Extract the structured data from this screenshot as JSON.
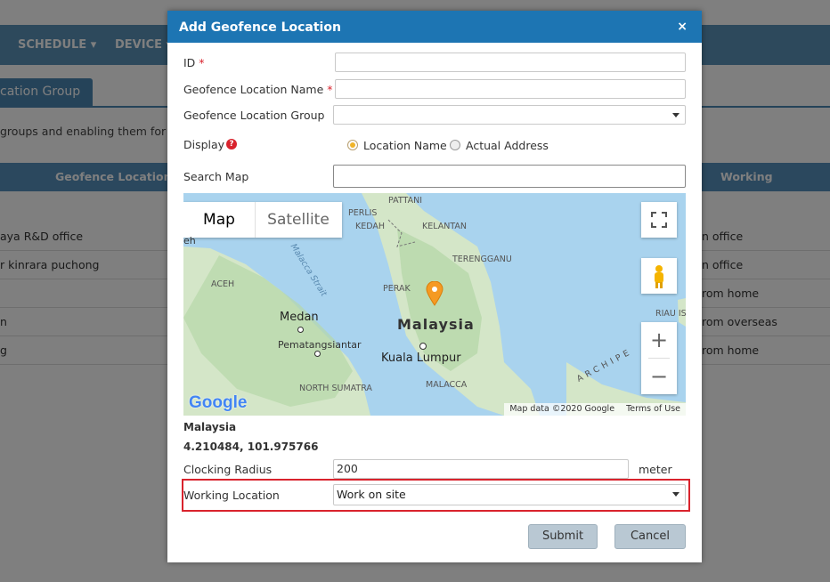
{
  "background": {
    "nav": [
      "SCHEDULE",
      "DEVICE"
    ],
    "tab_label": "cation Group",
    "description": "groups and enabling them for u",
    "columns": [
      "Geofence Location Na",
      "Working Location"
    ],
    "rows": [
      {
        "name": "aya R&D office",
        "working": "n office"
      },
      {
        "name": "r kinrara puchong",
        "working": "n office"
      },
      {
        "name": "",
        "working": "rom home"
      },
      {
        "name": "n",
        "working": "rom overseas"
      },
      {
        "name": "g",
        "working": "rom home"
      }
    ]
  },
  "modal": {
    "title": "Add Geofence Location",
    "close_label": "×",
    "fields": {
      "id_label": "ID",
      "name_label": "Geofence Location Name",
      "group_label": "Geofence Location Group",
      "display_label": "Display",
      "display_options": [
        "Location Name",
        "Actual Address"
      ],
      "display_selected": "Location Name",
      "search_label": "Search Map",
      "required_mark": "*",
      "help_mark": "?"
    },
    "map": {
      "tabs": [
        "Map",
        "Satellite"
      ],
      "labels": {
        "pattani": "PATTANI",
        "perlis": "PERLIS",
        "kedah": "KEDAH",
        "kelantan": "KELANTAN",
        "terengganu": "TERENGGANU",
        "aceh": "ACEH",
        "perak": "PERAK",
        "malaysia": "Malaysia",
        "medan": "Medan",
        "pematangsiantar": "Pematangsiantar",
        "kuala_lumpur": "Kuala Lumpur",
        "north_sumatra": "NORTH SUMATRA",
        "malacca": "MALACCA",
        "riau": "RIAU IS",
        "strait": "Malacca Strait",
        "archipelago": "ARCHIPE",
        "eh": "eh"
      },
      "google": "Google",
      "attribution": "Map data ©2020 Google",
      "terms": "Terms of Use",
      "zoom_in": "+",
      "zoom_out": "−"
    },
    "location_name": "Malaysia",
    "coordinates": "4.210484, 101.975766",
    "clocking_radius_label": "Clocking Radius",
    "clocking_radius_value": "200",
    "radius_unit": "meter",
    "working_location_label": "Working Location",
    "working_location_value": "Work on site",
    "submit_label": "Submit",
    "cancel_label": "Cancel",
    "highlight_color": "#d9232d"
  }
}
